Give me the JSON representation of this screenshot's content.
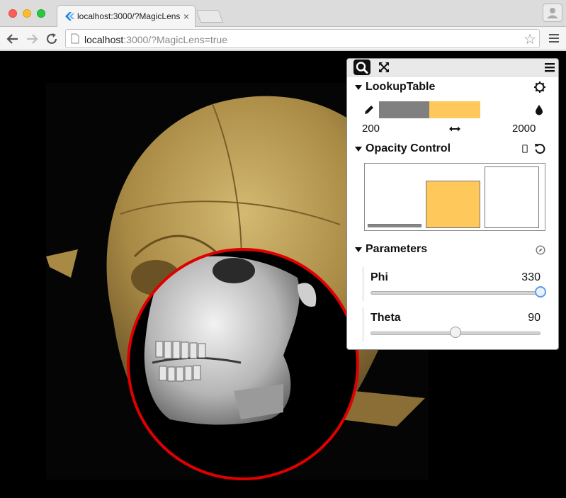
{
  "browser": {
    "tab_title": "localhost:3000/?MagicLens",
    "url_host": "localhost",
    "url_rest": ":3000/?MagicLens=true"
  },
  "panel": {
    "lookup_table": {
      "title": "LookupTable",
      "min": "200",
      "max": "2000",
      "colors": [
        "#808080",
        "#ffc85a"
      ]
    },
    "opacity": {
      "title": "Opacity Control"
    },
    "parameters": {
      "title": "Parameters",
      "phi": {
        "label": "Phi",
        "value": "330",
        "fraction": 1.0
      },
      "theta": {
        "label": "Theta",
        "value": "90",
        "fraction": 0.5
      }
    }
  },
  "scene": {
    "lens_color": "#e00000",
    "skull_color": "#b89a52",
    "bone_color": "#c8c8c8"
  }
}
